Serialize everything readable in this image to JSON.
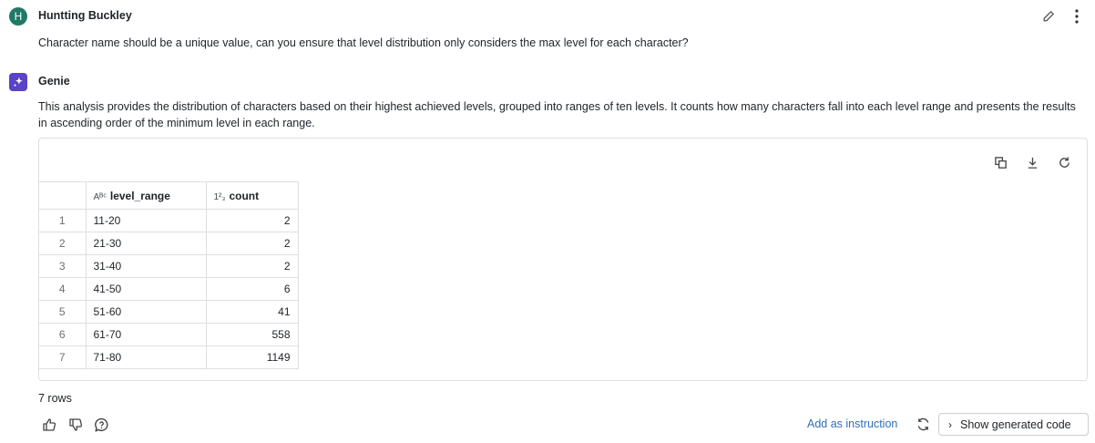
{
  "user_message": {
    "avatar_letter": "H",
    "author": "Huntting Buckley",
    "text": "Character name should be a unique value, can you ensure that level distribution only considers the max level for each character?"
  },
  "genie_message": {
    "name": "Genie",
    "text": "This analysis provides the distribution of characters based on their highest achieved levels, grouped into ranges of ten levels. It counts how many characters fall into each level range and presents the results in ascending order of the minimum level in each range."
  },
  "table": {
    "columns": [
      {
        "type_glyph": "Aᴮᶜ",
        "label": "level_range"
      },
      {
        "type_glyph": "1²₃",
        "label": "count"
      }
    ],
    "rows": [
      {
        "num": "1",
        "level_range": "11-20",
        "count": "2"
      },
      {
        "num": "2",
        "level_range": "21-30",
        "count": "2"
      },
      {
        "num": "3",
        "level_range": "31-40",
        "count": "2"
      },
      {
        "num": "4",
        "level_range": "41-50",
        "count": "6"
      },
      {
        "num": "5",
        "level_range": "51-60",
        "count": "41"
      },
      {
        "num": "6",
        "level_range": "61-70",
        "count": "558"
      },
      {
        "num": "7",
        "level_range": "71-80",
        "count": "1149"
      }
    ],
    "row_count_label": "7 rows"
  },
  "actions": {
    "add_instruction": "Add as instruction",
    "show_code": "Show generated code"
  },
  "icons": {
    "edit": "pencil-icon",
    "more": "kebab-icon",
    "genie": "sparkle-icon",
    "copy": "copy-icon",
    "download": "download-icon",
    "rerun": "refresh-icon",
    "thumbs_up": "thumbs-up-icon",
    "thumbs_down": "thumbs-down-icon",
    "comment": "comment-question-icon"
  },
  "colors": {
    "user_avatar": "#1f7a66",
    "genie_avatar": "#5a43c7",
    "link": "#2f6fba"
  }
}
